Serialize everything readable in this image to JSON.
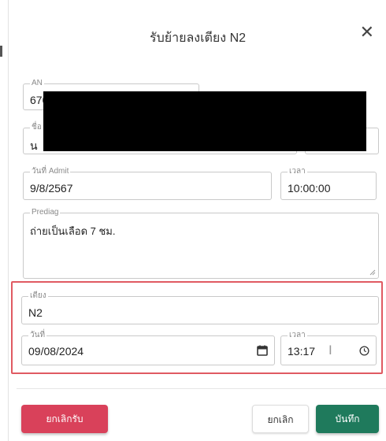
{
  "dialog": {
    "title": "รับย้ายลงเตียง N2",
    "close_glyph": "✕"
  },
  "fields": {
    "an": {
      "label": "AN",
      "value": "67000000"
    },
    "name": {
      "label": "ชื่อ",
      "value": "น"
    },
    "admit_date": {
      "label": "วันที่ Admit",
      "value": "9/8/2567"
    },
    "admit_time": {
      "label": "เวลา",
      "value": "10:00:00"
    },
    "prediag": {
      "label": "Prediag",
      "value": "ถ่ายเป็นเลือด 7 ชม."
    },
    "bed": {
      "label": "เตียง",
      "value": "N2"
    },
    "date": {
      "label": "วันที่",
      "value": "09/08/2024"
    },
    "time": {
      "label": "เวลา",
      "value": "13:17"
    }
  },
  "buttons": {
    "cancel_admit": "ยกเลิกรับ",
    "cancel": "ยกเลิก",
    "save": "บันทึก"
  },
  "colors": {
    "danger": "#d9415a",
    "primary": "#1f7a5c",
    "highlight": "#e05a62"
  },
  "icons": {
    "calendar": "calendar-icon",
    "clock": "clock-icon",
    "close": "close-icon"
  }
}
